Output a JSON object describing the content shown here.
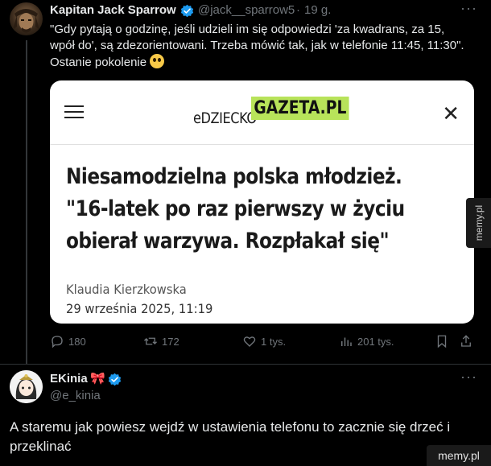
{
  "tweet": {
    "author_name": "Kapitan Jack Sparrow",
    "handle": "@jack__sparrow5",
    "separator": "·",
    "time": "19 g.",
    "text_line1": "\"Gdy pytają o godzinę, jeśli udzieli im się odpowiedzi 'za kwadrans, za 15,",
    "text_line2": "wpół do', są zdezorientowani. Trzeba mówić tak, jak w telefonie 11:45, 11:30\".",
    "text_line3": "Ostanie pokolenie",
    "emoji": "flushed-face",
    "verified_color": "#1d9bf0",
    "more_label": "···"
  },
  "card": {
    "logo_left": "eDZIECKO",
    "logo_right": "GAZETA.PL",
    "logo_accent": "#b8e35a",
    "close_label": "✕",
    "headline_line1": "Niesamodzielna polska młodzież.",
    "headline_line2": "\"16-latek po raz pierwszy w życiu",
    "headline_line3": "obierał warzywa. Rozpłakał się\"",
    "author": "Klaudia Kierzkowska",
    "date": "29 września 2025, 11:19"
  },
  "actions": {
    "replies": "180",
    "retweets": "172",
    "likes": "1 tys.",
    "views": "201 tys."
  },
  "reply": {
    "author_name": "EKinia",
    "bow_emoji": "🎀",
    "handle": "@e_kinia",
    "more_label": "···",
    "text": "A staremu jak powiesz wejdź w ustawienia telefonu to zacznie się drzeć i przeklinać"
  },
  "watermarks": {
    "side": "memy.pl",
    "bottom": "memy.pl"
  }
}
